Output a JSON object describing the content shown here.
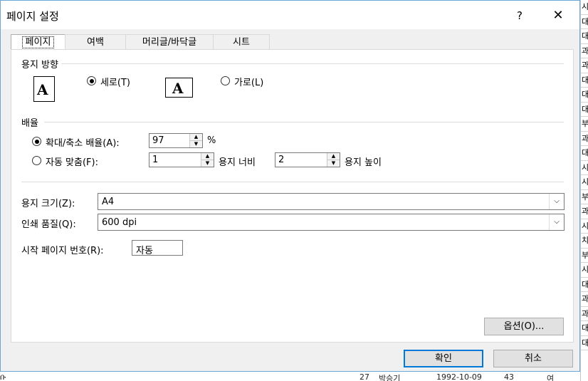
{
  "window": {
    "title": "페이지 설정",
    "help_label": "?",
    "close_label": "✕"
  },
  "tabs": [
    {
      "label": "페이지"
    },
    {
      "label": "여백"
    },
    {
      "label": "머리글/바닥글"
    },
    {
      "label": "시트"
    }
  ],
  "orientation": {
    "group_label": "용지 방향",
    "portrait_label": "세로(T)",
    "landscape_label": "가로(L)",
    "icon_letter": "A",
    "selected": "portrait"
  },
  "scaling": {
    "group_label": "배율",
    "adjust_label": "확대/축소 배율(A):",
    "adjust_value": "97",
    "percent_sign": "%",
    "fit_label": "자동 맞춤(F):",
    "pages_wide_value": "1",
    "pages_wide_label": "용지 너비",
    "pages_tall_value": "2",
    "pages_tall_label": "용지 높이",
    "selected": "adjust"
  },
  "paper_size": {
    "label": "용지 크기(Z):",
    "value": "A4"
  },
  "print_quality": {
    "label": "인쇄 품질(Q):",
    "value": "600 dpi"
  },
  "first_page": {
    "label": "시작 페이지 번호(R):",
    "value": "자동"
  },
  "buttons": {
    "options": "옵션(O)...",
    "ok": "확인",
    "cancel": "취소"
  },
  "background_sheet": {
    "right_column": [
      "시",
      "대",
      "대",
      "과",
      "과",
      "대",
      "대",
      "대",
      "부",
      "과",
      "대",
      "시",
      "시",
      "부",
      "과",
      "시",
      "치",
      "부",
      "시",
      "대",
      "과",
      "과",
      "대",
      "대"
    ],
    "bottom_row": [
      "27",
      "박승기",
      "1992-10-09",
      "43",
      "여"
    ],
    "left_fragment": "ቡ"
  }
}
